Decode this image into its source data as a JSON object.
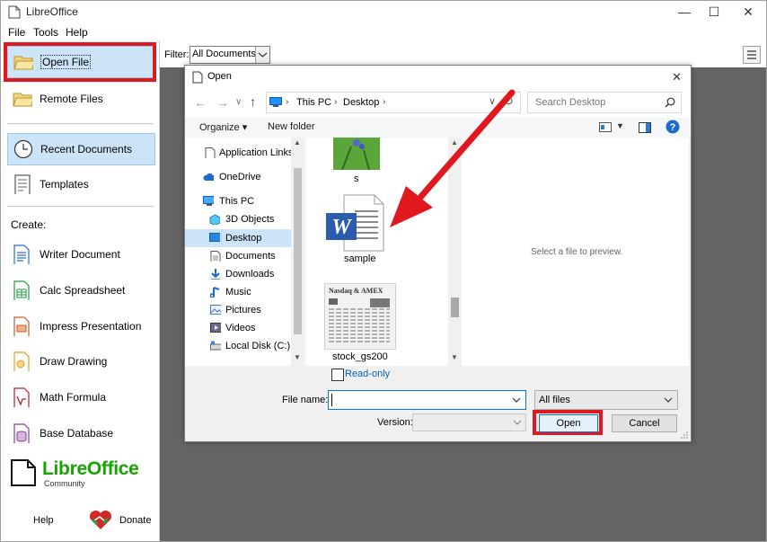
{
  "app": {
    "title": "LibreOffice",
    "window_controls": {
      "minimize": "—",
      "maximize": "☐",
      "close": "✕"
    }
  },
  "menu": [
    "File",
    "Tools",
    "Help"
  ],
  "sidebar": {
    "open_file": "Open File",
    "remote_files": "Remote Files",
    "recent_documents": "Recent Documents",
    "templates": "Templates",
    "create_label": "Create:",
    "create_items": [
      {
        "label": "Writer Document",
        "icon": "writer-icon",
        "color": "#2a6cc0"
      },
      {
        "label": "Calc Spreadsheet",
        "icon": "calc-icon",
        "color": "#1f9c3a"
      },
      {
        "label": "Impress Presentation",
        "icon": "impress-icon",
        "color": "#d0582a"
      },
      {
        "label": "Draw Drawing",
        "icon": "draw-icon",
        "color": "#e89a1c"
      },
      {
        "label": "Math Formula",
        "icon": "math-icon",
        "color": "#b81f2b"
      },
      {
        "label": "Base Database",
        "icon": "base-icon",
        "color": "#8a3a9e"
      }
    ],
    "logo_text": "LibreOffice",
    "logo_sub": "Community",
    "help": "Help",
    "donate": "Donate"
  },
  "filter": {
    "label": "Filter:",
    "value": "All Documents"
  },
  "dialog": {
    "title": "Open",
    "close": "✕",
    "breadcrumb": [
      "This PC",
      "Desktop"
    ],
    "search_placeholder": "Search Desktop",
    "organize": "Organize ▾",
    "new_folder": "New folder",
    "nav_items": [
      {
        "label": "Application Links",
        "icon": "file-icon",
        "indent": 0
      },
      {
        "label": "OneDrive",
        "icon": "cloud-icon",
        "indent": 0
      },
      {
        "label": "This PC",
        "icon": "computer-icon",
        "indent": 0
      },
      {
        "label": "3D Objects",
        "icon": "cube-icon",
        "indent": 1
      },
      {
        "label": "Desktop",
        "icon": "desktop-icon",
        "indent": 1
      },
      {
        "label": "Documents",
        "icon": "documents-icon",
        "indent": 1
      },
      {
        "label": "Downloads",
        "icon": "download-icon",
        "indent": 1
      },
      {
        "label": "Music",
        "icon": "music-icon",
        "indent": 1
      },
      {
        "label": "Pictures",
        "icon": "pictures-icon",
        "indent": 1
      },
      {
        "label": "Videos",
        "icon": "videos-icon",
        "indent": 1
      },
      {
        "label": "Local Disk (C:)",
        "icon": "disk-icon",
        "indent": 1
      }
    ],
    "files": [
      {
        "name": "s",
        "type": "image"
      },
      {
        "name": "sample",
        "type": "word"
      },
      {
        "name": "stock_gs200",
        "type": "newspaper"
      }
    ],
    "newspaper_headline": "Nasdaq & AMEX",
    "preview_text": "Select a file to preview.",
    "read_only": "Read-only",
    "file_name_label": "File name:",
    "file_name_value": "",
    "file_type": "All files",
    "version_label": "Version:",
    "version_value": "",
    "open_button": "Open",
    "cancel_button": "Cancel"
  },
  "colors": {
    "highlight_red": "#e0191f",
    "selection_blue": "#cce4f7",
    "grey_background": "#646464",
    "accent_blue": "#0063b1"
  }
}
